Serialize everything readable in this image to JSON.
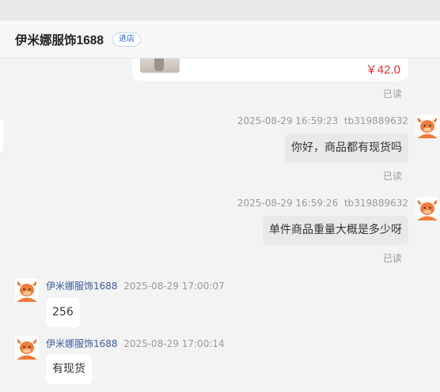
{
  "header": {
    "shop_name": "伊米娜服饰1688",
    "enter_shop_label": "进店"
  },
  "product_card": {
    "price": "￥42.0"
  },
  "read_label": "已读",
  "messages": [
    {
      "side": "mine",
      "time": "2025-08-29 16:59:23",
      "sender": "tb319889632",
      "text": "你好，商品都有现货吗",
      "status": "已读"
    },
    {
      "side": "mine",
      "time": "2025-08-29 16:59:26",
      "sender": "tb319889632",
      "text": "单件商品重量大概是多少呀",
      "status": "已读"
    },
    {
      "side": "theirs",
      "sender": "伊米娜服饰1688",
      "time": "2025-08-29 17:00:07",
      "text": "256"
    },
    {
      "side": "theirs",
      "sender": "伊米娜服饰1688",
      "time": "2025-08-29 17:00:14",
      "text": "有现货"
    }
  ],
  "colors": {
    "price": "#d7322f",
    "nickname": "#3b5b9c",
    "enter_button": "#2f6fd0",
    "avatar_orange": "#f07d3c"
  },
  "icons": {
    "avatar": "cartoon-cow-avatar-icon"
  }
}
